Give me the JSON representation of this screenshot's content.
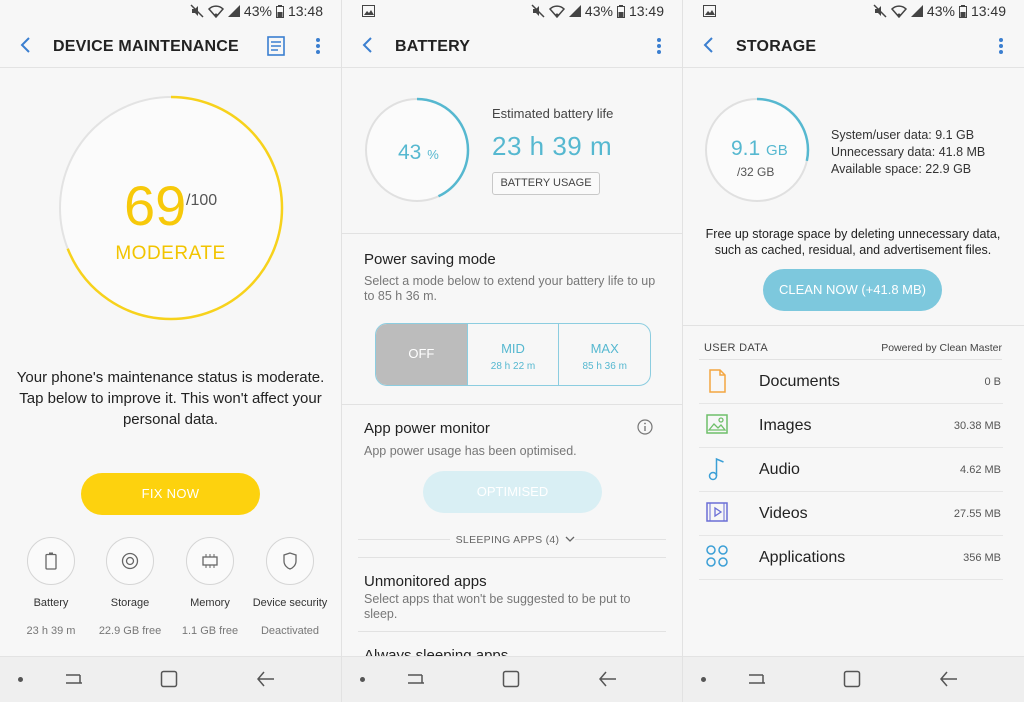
{
  "colors": {
    "accent_yellow": "#fdd20e",
    "accent_blue": "#56b8d0",
    "background": "#f7f7f7"
  },
  "panels": [
    {
      "status": {
        "battery": "43%",
        "time": "13:48"
      },
      "title": "DEVICE MAINTENANCE",
      "score": {
        "value": "69",
        "max": "/100",
        "fraction": 0.69,
        "status": "MODERATE"
      },
      "message": "Your phone's maintenance status is moderate. Tap below to improve it. This won't affect your personal data.",
      "fix_label": "FIX NOW",
      "tiles": [
        {
          "label": "Battery",
          "value": "23 h 39 m",
          "icon": "battery-icon"
        },
        {
          "label": "Storage",
          "value": "22.9 GB free",
          "icon": "storage-icon"
        },
        {
          "label": "Memory",
          "value": "1.1 GB free",
          "icon": "memory-icon"
        },
        {
          "label": "Device security",
          "value": "Deactivated",
          "icon": "shield-icon"
        }
      ]
    },
    {
      "status": {
        "battery": "43%",
        "time": "13:49"
      },
      "title": "BATTERY",
      "battery": {
        "percent": "43",
        "unit": "%",
        "fraction": 0.43
      },
      "estimate_label": "Estimated battery life",
      "estimate_value": "23 h 39 m",
      "usage_label": "BATTERY USAGE",
      "power_saving": {
        "title": "Power saving mode",
        "desc": "Select a mode below to extend your battery life to up to 85 h 36 m.",
        "modes": [
          {
            "name": "OFF",
            "sub": ""
          },
          {
            "name": "MID",
            "sub": "28 h 22 m"
          },
          {
            "name": "MAX",
            "sub": "85 h 36 m"
          }
        ]
      },
      "app_monitor": {
        "title": "App power monitor",
        "desc": "App power usage has been optimised.",
        "button": "OPTIMISED"
      },
      "sleeping_label": "SLEEPING APPS (4)",
      "unmonitored": {
        "title": "Unmonitored apps",
        "desc": "Select apps that won't be suggested to be put to sleep."
      },
      "always_sleeping": "Always sleeping apps"
    },
    {
      "status": {
        "battery": "43%",
        "time": "13:49"
      },
      "title": "STORAGE",
      "storage": {
        "used": "9.1",
        "unit": "GB",
        "total": "/32 GB",
        "fraction": 0.284
      },
      "stats": [
        "System/user data: 9.1 GB",
        "Unnecessary data: 41.8 MB",
        "Available space: 22.9 GB"
      ],
      "desc": "Free up storage space by deleting unnecessary data, such as cached, residual, and advertisement files.",
      "clean_label": "CLEAN NOW (+41.8 MB)",
      "user_data_label": "USER DATA",
      "powered_by": "Powered by Clean Master",
      "items": [
        {
          "name": "Documents",
          "size": "0 B",
          "icon": "document-icon"
        },
        {
          "name": "Images",
          "size": "30.38 MB",
          "icon": "image-icon"
        },
        {
          "name": "Audio",
          "size": "4.62 MB",
          "icon": "audio-icon"
        },
        {
          "name": "Videos",
          "size": "27.55 MB",
          "icon": "video-icon"
        },
        {
          "name": "Applications",
          "size": "356 MB",
          "icon": "apps-icon"
        }
      ]
    }
  ]
}
